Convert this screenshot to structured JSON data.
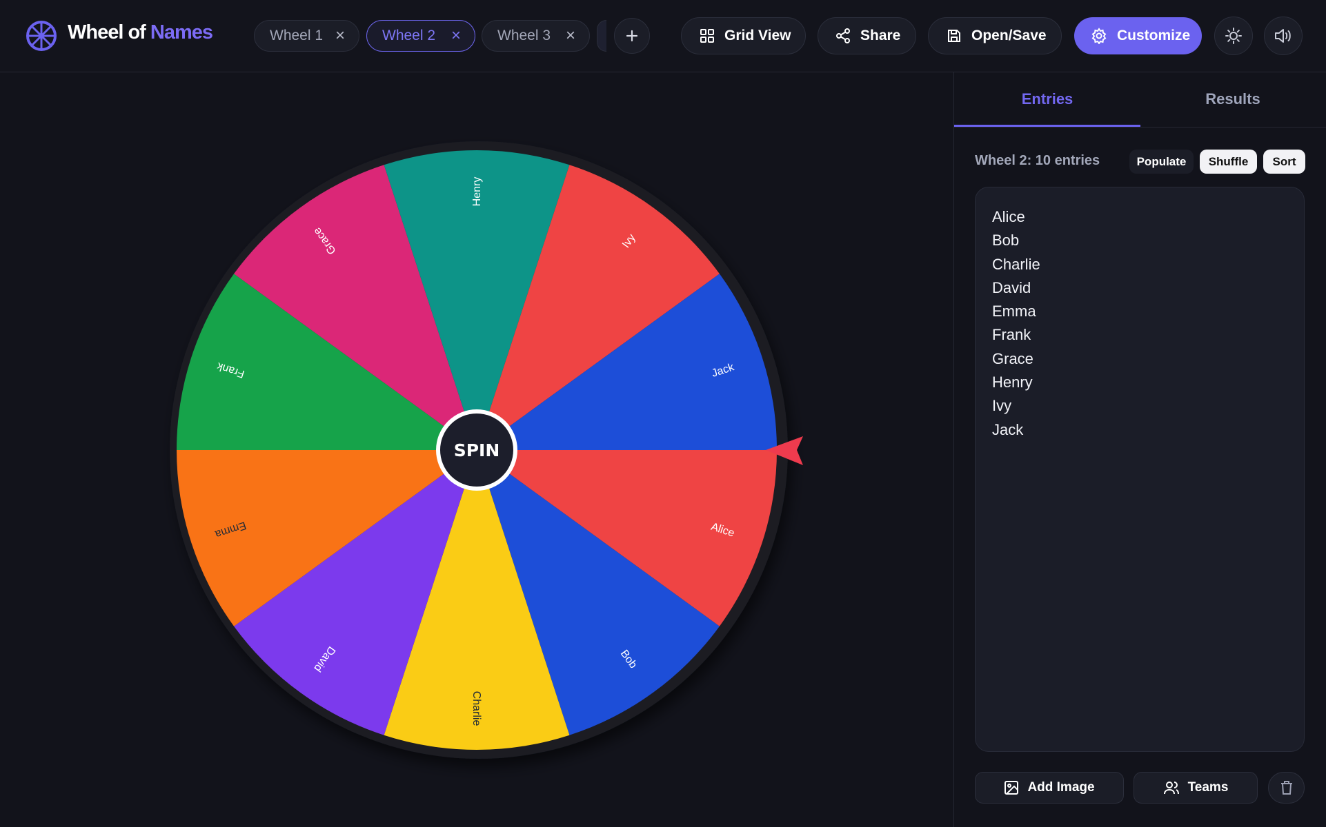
{
  "header": {
    "brand_main": "Wheel of ",
    "brand_accent": "Names",
    "tabs": [
      {
        "label": "Wheel 1",
        "close": "×",
        "active": false
      },
      {
        "label": "Wheel 2",
        "close": "×",
        "active": true
      },
      {
        "label": "Wheel 3",
        "close": "×",
        "active": false
      }
    ],
    "add_tab_icon": "plus-icon",
    "buttons": {
      "grid_view": "Grid View",
      "share": "Share",
      "open_save": "Open/Save",
      "customize": "Customize"
    },
    "icons": [
      "wheel-logo-icon",
      "grid-icon",
      "share-icon",
      "save-icon",
      "settings-icon",
      "sun-icon",
      "volume-icon"
    ]
  },
  "wheel": {
    "spin_label": "SPIN",
    "pointer_color": "#ee3b4e",
    "segments": [
      {
        "label": "Alice",
        "color": "#ef4444",
        "text_color": "#ffffff"
      },
      {
        "label": "Bob",
        "color": "#1d4ed8",
        "text_color": "#ffffff"
      },
      {
        "label": "Charlie",
        "color": "#facc15",
        "text_color": "#1f2937"
      },
      {
        "label": "David",
        "color": "#7c3aed",
        "text_color": "#ffffff"
      },
      {
        "label": "Emma",
        "color": "#f97316",
        "text_color": "#1f2937"
      },
      {
        "label": "Frank",
        "color": "#16a34a",
        "text_color": "#ffffff"
      },
      {
        "label": "Grace",
        "color": "#db2777",
        "text_color": "#ffffff"
      },
      {
        "label": "Henry",
        "color": "#0d9488",
        "text_color": "#ffffff"
      },
      {
        "label": "Ivy",
        "color": "#ef4444",
        "text_color": "#ffffff"
      },
      {
        "label": "Jack",
        "color": "#1d4ed8",
        "text_color": "#ffffff"
      }
    ]
  },
  "sidebar": {
    "tabs": [
      {
        "label": "Entries",
        "active": true
      },
      {
        "label": "Results",
        "active": false
      }
    ],
    "count_label": "Wheel 2: 10 entries",
    "actions": {
      "populate": "Populate",
      "shuffle": "Shuffle",
      "sort": "Sort"
    },
    "entries": [
      "Alice",
      "Bob",
      "Charlie",
      "David",
      "Emma",
      "Frank",
      "Grace",
      "Henry",
      "Ivy",
      "Jack"
    ],
    "bottom": {
      "add_image": "Add Image",
      "teams": "Teams"
    }
  },
  "colors": {
    "accent": "#6b62ef",
    "background": "#12131b"
  }
}
